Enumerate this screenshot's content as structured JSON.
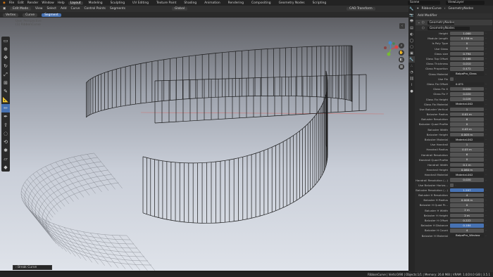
{
  "topbar": {
    "menu": [
      "File",
      "Edit",
      "Render",
      "Window",
      "Help"
    ],
    "workspaces": [
      "Layout",
      "Modeling",
      "Sculpting",
      "UV Editing",
      "Texture Paint",
      "Shading",
      "Animation",
      "Rendering",
      "Compositing",
      "Geometry Nodes",
      "Scripting"
    ],
    "active_workspace": "Layout",
    "scene": "Scene",
    "view_layer": "ViewLayer"
  },
  "viewport_header": {
    "mode": "Edit Mode",
    "menus": [
      "View",
      "Select",
      "Add",
      "Curve",
      "Control Points",
      "Segments"
    ],
    "transform": "Global",
    "pivot": "CAD Transform"
  },
  "viewport_header2": {
    "items": [
      "Vertex",
      "Curve",
      "Segment"
    ],
    "selected": "Segment"
  },
  "viewport_text": {
    "line1": "User Perspective",
    "line2": "(1) RibbonCurve"
  },
  "last_op": "Break Curve",
  "statusbar": {
    "left": "",
    "right": "RibbonCurve | Verts:0/90 | Objects:1/1 | Memory: 26.8 MiB | VRAM: 1.0/24.0 GiB | 3.5.1"
  },
  "properties": {
    "object_name": "RibbonCurve",
    "modifier_name": "GeometryNodes",
    "add_modifier": "Add Modifier",
    "node_group": "GeometryNodes",
    "rows": [
      {
        "label": "Height",
        "value": "1.000",
        "type": "num"
      },
      {
        "label": "Module Length",
        "value": "0.138 m",
        "type": "num"
      },
      {
        "label": "Is Poly Type",
        "value": "0",
        "type": "num"
      },
      {
        "label": "Use Glass",
        "value": "0",
        "type": "num"
      },
      {
        "label": "Glass size",
        "value": "0.794",
        "type": "num"
      },
      {
        "label": "Glass Top Offset",
        "value": "0.188",
        "type": "num"
      },
      {
        "label": "Glass Thickness",
        "value": "0.010",
        "type": "num"
      },
      {
        "label": "Glass Proportion",
        "value": "0.472",
        "type": "num"
      },
      {
        "label": "Glass Material",
        "value": "BalpaPro_Glass",
        "type": "mat"
      },
      {
        "label": "Use Fix",
        "value": "",
        "type": "chk"
      },
      {
        "label": "Glass Fix Offset",
        "value": "0.071",
        "type": "mat2"
      },
      {
        "label": "Glass Fix X",
        "value": "0.020",
        "type": "num"
      },
      {
        "label": "Glass Fix Y",
        "value": "0.020",
        "type": "num"
      },
      {
        "label": "Glass Fix Height",
        "value": "0.028",
        "type": "num"
      },
      {
        "label": "Glass Fix Material",
        "value": "Material.002",
        "type": "mat"
      },
      {
        "label": "Use Baluster Vertical",
        "value": "1",
        "type": "num"
      },
      {
        "label": "Baluster Radius",
        "value": "0.01 m",
        "type": "num"
      },
      {
        "label": "Baluster Resolution",
        "value": "6",
        "type": "num"
      },
      {
        "label": "Baluster Quad Profile",
        "value": "0",
        "type": "num"
      },
      {
        "label": "Baluster Width",
        "value": "0.05 m",
        "type": "num"
      },
      {
        "label": "Baluster Height",
        "value": "0.005 m",
        "type": "num"
      },
      {
        "label": "Baluster Material",
        "value": "Material.002",
        "type": "mat"
      },
      {
        "label": "Use Handrail",
        "value": "1",
        "type": "num"
      },
      {
        "label": "Handrail Radius",
        "value": "0.05 m",
        "type": "num"
      },
      {
        "label": "Handrail Resolution",
        "value": "6",
        "type": "num"
      },
      {
        "label": "Handrail Quad Profile",
        "value": "0",
        "type": "num"
      },
      {
        "label": "Handrail Width",
        "value": "0.1 m",
        "type": "num"
      },
      {
        "label": "Handrail Height",
        "value": "0.060 m",
        "type": "num"
      },
      {
        "label": "Handrail Material",
        "value": "Material.002",
        "type": "mat"
      },
      {
        "label": "Handrail Resolution (...)",
        "value": "0.020",
        "type": "num"
      },
      {
        "label": "Use Baluster Horizo...",
        "value": "",
        "type": "chk"
      },
      {
        "label": "Baluster Resolution (...)",
        "value": "1.597",
        "type": "blue"
      },
      {
        "label": "Baluster H Resolution",
        "value": "4",
        "type": "num"
      },
      {
        "label": "Baluster H Radius",
        "value": "0.008 m",
        "type": "num"
      },
      {
        "label": "Baluster H Quad Pr...",
        "value": "0",
        "type": "num"
      },
      {
        "label": "Baluster H Width",
        "value": "2 m",
        "type": "num"
      },
      {
        "label": "Baluster H Height",
        "value": "2 m",
        "type": "num"
      },
      {
        "label": "Baluster H Offset",
        "value": "0.222",
        "type": "num"
      },
      {
        "label": "Baluster H Distance",
        "value": "0.184",
        "type": "blue"
      },
      {
        "label": "Baluster H Count",
        "value": "4",
        "type": "num"
      },
      {
        "label": "Baluster H Material",
        "value": "BalpaPro_Window",
        "type": "mat"
      }
    ]
  },
  "colors": {
    "accent": "#4772b3",
    "background": "#1d1d1d",
    "viewport_top": "#5c5d62",
    "viewport_bottom": "#d8dde6"
  }
}
